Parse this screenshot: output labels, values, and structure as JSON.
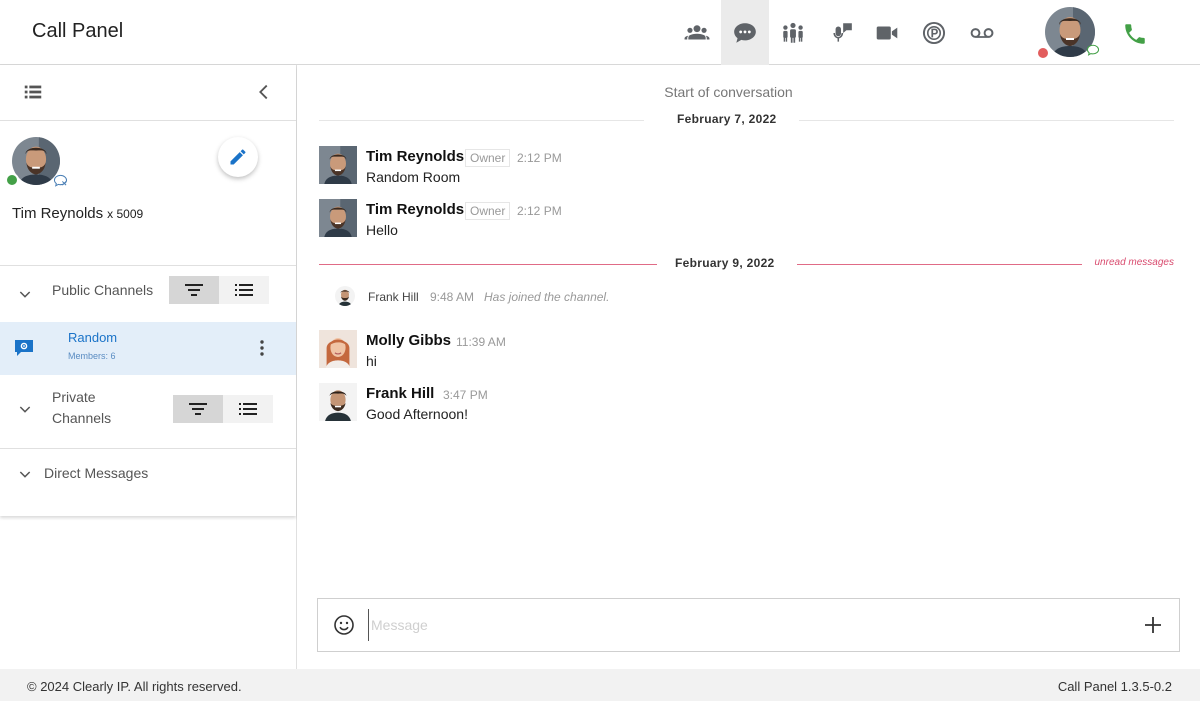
{
  "app": {
    "title": "Call Panel"
  },
  "header": {
    "nav": [
      {
        "icon": "contacts-group-icon",
        "active": false
      },
      {
        "icon": "chat-bubble-icon",
        "active": true
      },
      {
        "icon": "conference-people-icon",
        "active": false
      },
      {
        "icon": "voicemail-mic-icon",
        "active": false
      },
      {
        "icon": "video-camera-icon",
        "active": false
      },
      {
        "icon": "parking-icon",
        "active": false
      },
      {
        "icon": "voicemail-icon",
        "active": false
      }
    ],
    "user_status_color": "#e25d5d",
    "call_icon_color": "#43a047"
  },
  "sidebar": {
    "profile": {
      "name": "Tim Reynolds",
      "extension": "x 5009",
      "status_color": "#43a047"
    },
    "public_channels": {
      "label": "Public Channels",
      "channels": [
        {
          "name": "Random",
          "members": "Members: 6"
        }
      ]
    },
    "private_channels": {
      "label": "Private Channels"
    },
    "direct_messages": {
      "label": "Direct Messages"
    }
  },
  "chat": {
    "start_label": "Start of conversation",
    "date1": "February 7, 2022",
    "date2": "February 9, 2022",
    "unread_label": "unread messages",
    "messages": [
      {
        "sender": "Tim Reynolds",
        "badge": "Owner",
        "time": "2:12 PM",
        "text": "Random Room"
      },
      {
        "sender": "Tim Reynolds",
        "badge": "Owner",
        "time": "2:12 PM",
        "text": "Hello"
      },
      {
        "sender": "Molly Gibbs",
        "time": "11:39 AM",
        "text": "hi"
      },
      {
        "sender": "Frank Hill",
        "time": "3:47 PM",
        "text": "Good Afternoon!"
      }
    ],
    "join_event": {
      "name": "Frank Hill",
      "time": "9:48 AM",
      "text": "Has joined the channel."
    },
    "composer": {
      "placeholder": "Message"
    },
    "accent_unread": "#e06b86"
  },
  "footer": {
    "copyright": "© 2024 Clearly IP. All rights reserved.",
    "version": "Call Panel 1.3.5-0.2"
  }
}
